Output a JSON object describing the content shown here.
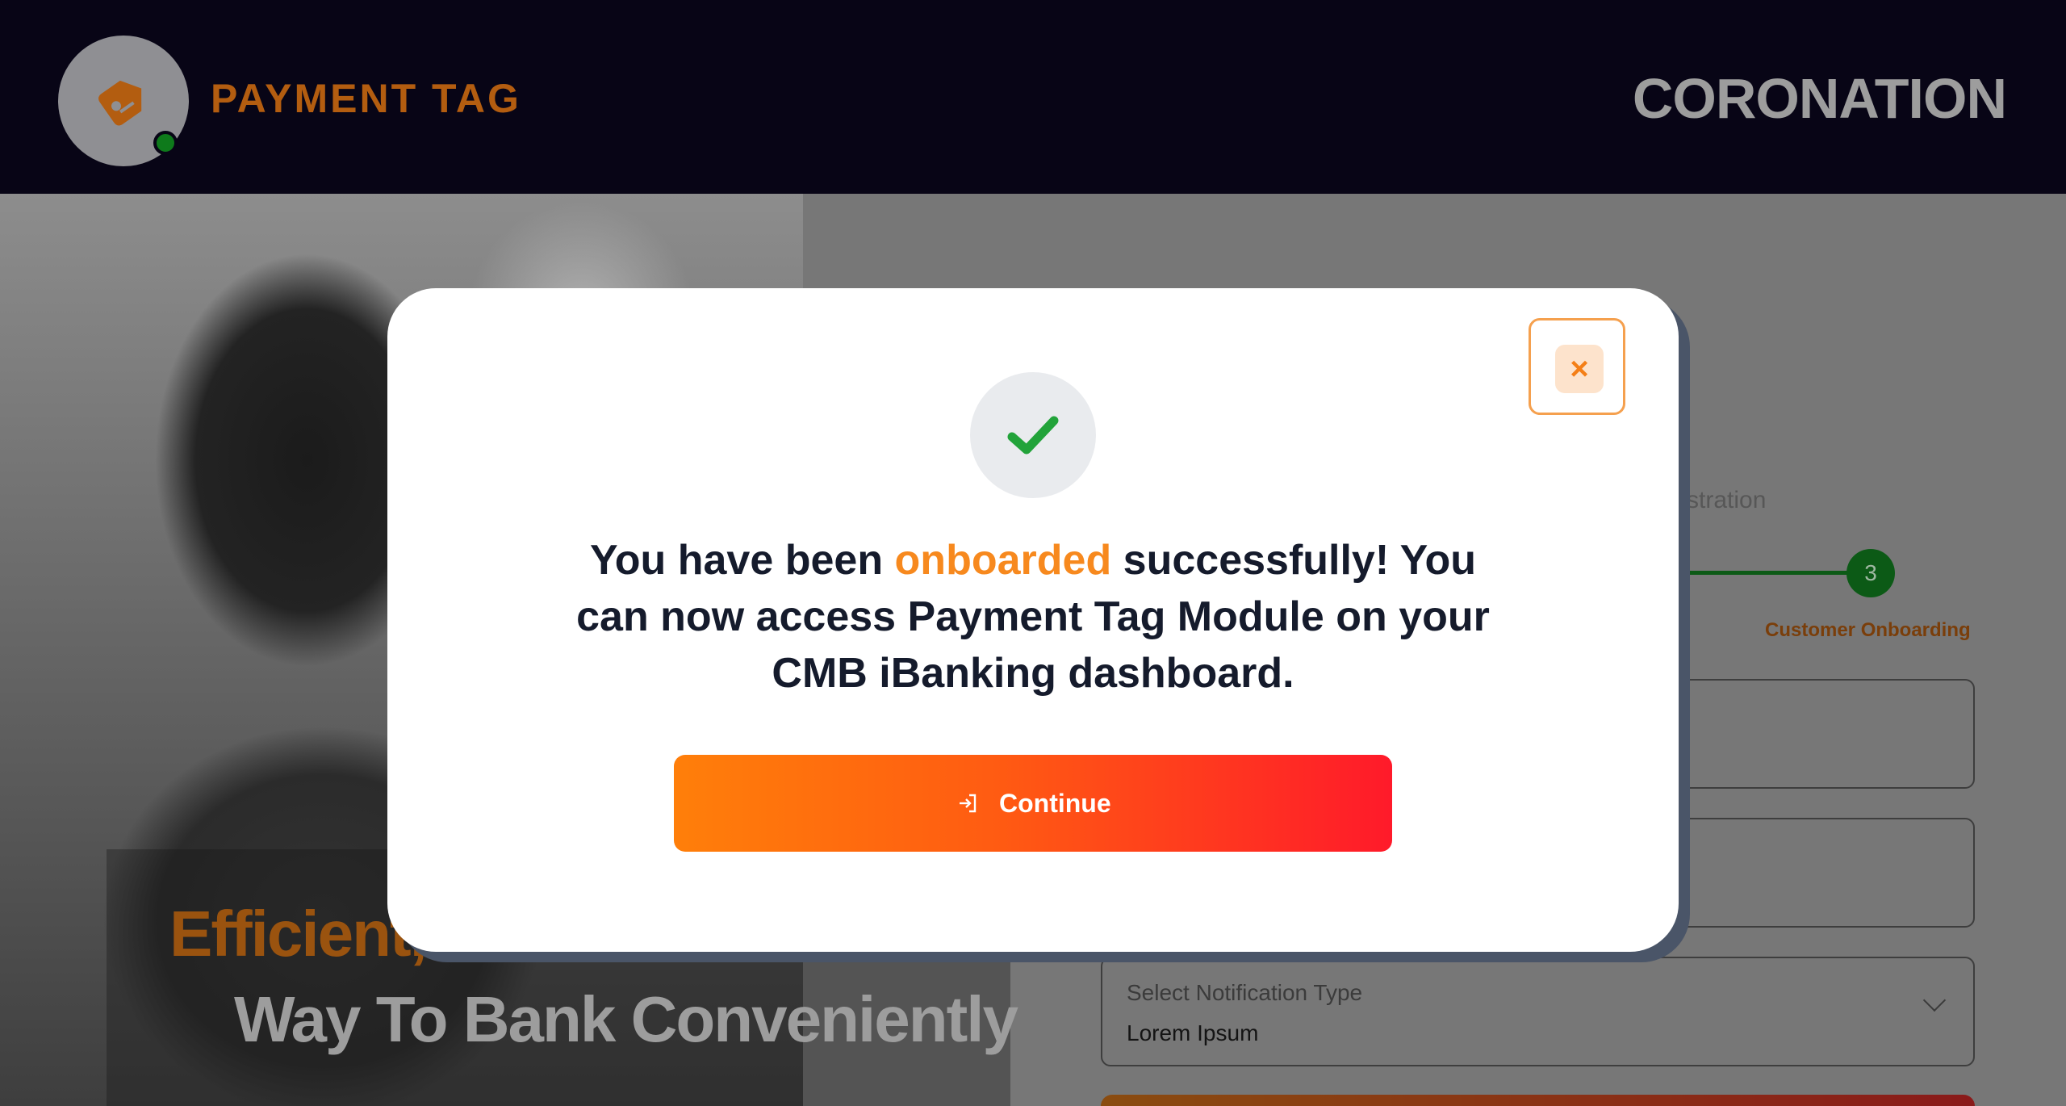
{
  "header": {
    "brand_title": "PAYMENT TAG",
    "brand_right": "CORONATION"
  },
  "background": {
    "tagline_line1": "Efficient,",
    "tagline_line2": "Way To Bank Conveniently",
    "step_label_partial": "stration",
    "step_number": "3",
    "step_caption": "Customer Onboarding",
    "notification_field": {
      "label": "Select Notification Type",
      "value": "Lorem Ipsum"
    }
  },
  "modal": {
    "close_icon": "close-icon",
    "success_icon": "checkmark-icon",
    "message_part1": "You have been ",
    "message_highlight": "onboarded",
    "message_part2": " successfully! You can now access Payment Tag Module on your CMB iBanking dashboard.",
    "continue_label": "Continue"
  },
  "colors": {
    "header_bg": "#080516",
    "brand_orange": "#b35d10",
    "highlight_orange": "#f7891e",
    "check_green": "#22a33a",
    "button_gradient_start": "#ff7f0a",
    "button_gradient_end": "#ff1a2a"
  }
}
